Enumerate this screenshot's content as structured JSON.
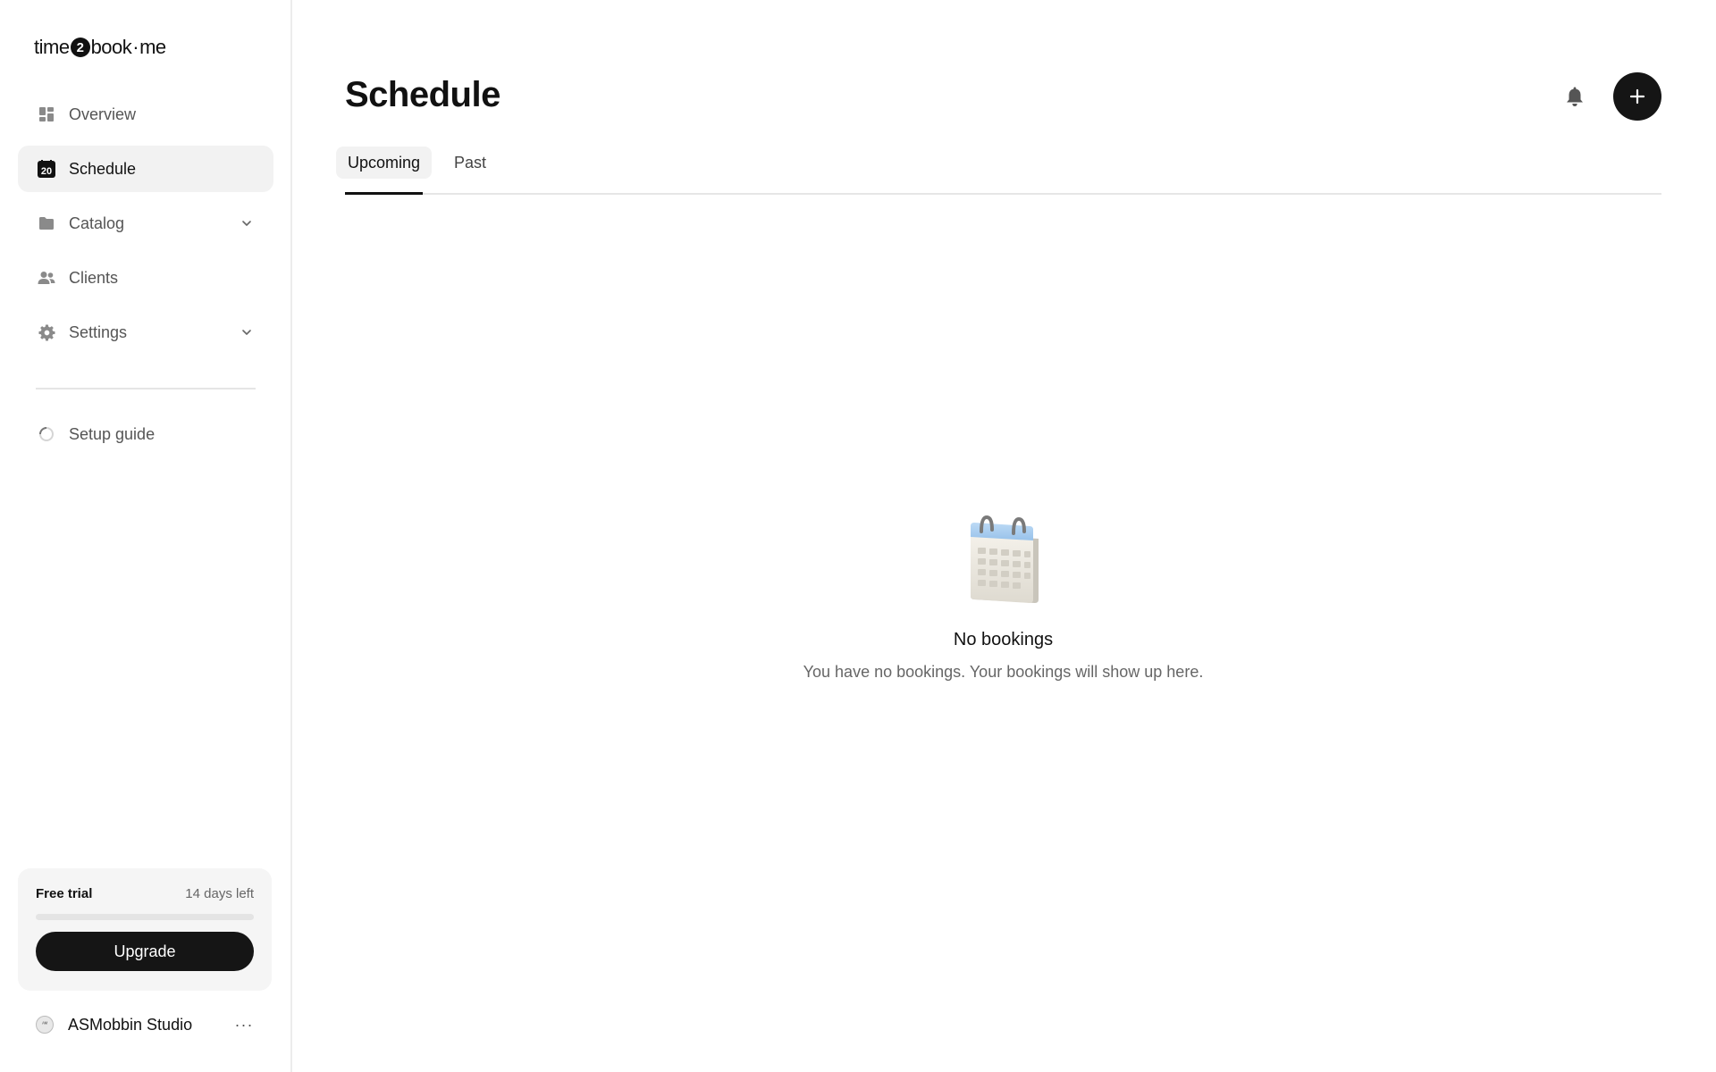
{
  "app": {
    "logo_part1": "time",
    "logo_mark": "2",
    "logo_part2": "book",
    "logo_dot": "·",
    "logo_part3": "me"
  },
  "sidebar": {
    "items": [
      {
        "label": "Overview",
        "icon": "dashboard-icon"
      },
      {
        "label": "Schedule",
        "icon": "calendar-day-icon",
        "badge": "20",
        "active": true
      },
      {
        "label": "Catalog",
        "icon": "folder-icon",
        "expandable": true
      },
      {
        "label": "Clients",
        "icon": "people-icon"
      },
      {
        "label": "Settings",
        "icon": "gear-icon",
        "expandable": true
      }
    ],
    "setup_guide": {
      "label": "Setup guide",
      "icon": "progress-ring-icon"
    }
  },
  "trial": {
    "label": "Free trial",
    "days_left": "14 days left",
    "progress": 0,
    "upgrade_label": "Upgrade"
  },
  "account": {
    "name": "ASMobbin Studio",
    "avatar_text": "ᴬᴹ",
    "more_label": "···"
  },
  "header": {
    "title": "Schedule",
    "bell_icon": "bell-icon",
    "add_icon": "plus-icon"
  },
  "tabs": [
    {
      "label": "Upcoming",
      "active": true
    },
    {
      "label": "Past",
      "active": false
    }
  ],
  "empty_state": {
    "icon": "calendar-illustration",
    "title": "No bookings",
    "text": "You have no bookings. Your bookings will show up here."
  },
  "colors": {
    "accent": "#151515",
    "active_bg": "#f2f2f2",
    "muted_text": "#666666",
    "calendar_top": "#a9cdef"
  }
}
